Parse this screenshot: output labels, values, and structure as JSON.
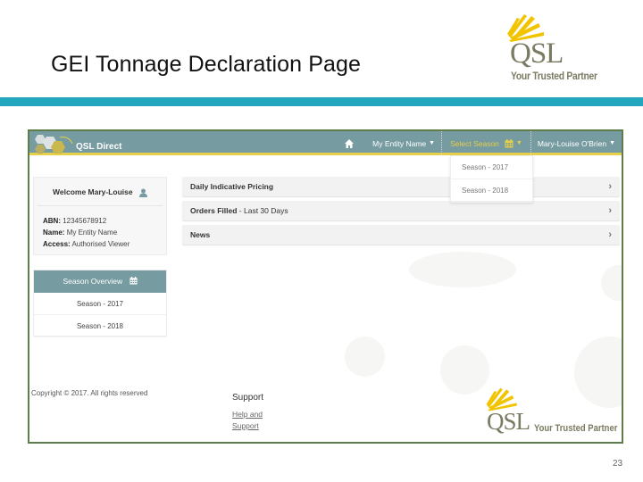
{
  "slide": {
    "title": "GEI Tonnage Declaration Page",
    "page_number": "23",
    "logo": {
      "brand": "QSL",
      "tagline": "Your Trusted Partner"
    },
    "colors": {
      "band": "#25a6bf",
      "frame_border": "#5e7d4b"
    }
  },
  "app": {
    "brand": "QSL Direct",
    "colors": {
      "navbar": "#769ba0",
      "accent": "#e6cf49"
    },
    "nav": {
      "home_icon": "home-icon",
      "entity": "My Entity Name",
      "season": "Select Season",
      "season_icon": "calendar-icon",
      "user": "Mary-Louise O'Brien"
    },
    "season_dropdown": {
      "options": [
        "Season - 2017",
        "Season - 2018"
      ]
    },
    "welcome": {
      "title": "Welcome Mary-Louise",
      "icon": "user-icon",
      "abn_label": "ABN:",
      "abn_value": "12345678912",
      "name_label": "Name:",
      "name_value": "My Entity Name",
      "access_label": "Access:",
      "access_value": "Authorised Viewer"
    },
    "season_overview": {
      "title": "Season Overview",
      "icon": "calendar-icon",
      "items": [
        "Season - 2017",
        "Season - 2018"
      ]
    },
    "panels": [
      {
        "bold": "Daily Indicative Pricing",
        "rest": ""
      },
      {
        "bold": "Orders Filled",
        "rest": " - Last 30 Days"
      },
      {
        "bold": "News",
        "rest": ""
      }
    ],
    "footer": {
      "copyright": "Copyright © 2017. All rights reserved",
      "support_heading": "Support",
      "support_link_1": "Help and",
      "support_link_2": "Support"
    },
    "footer_logo": {
      "brand": "QSL",
      "tagline": "Your Trusted Partner"
    }
  }
}
